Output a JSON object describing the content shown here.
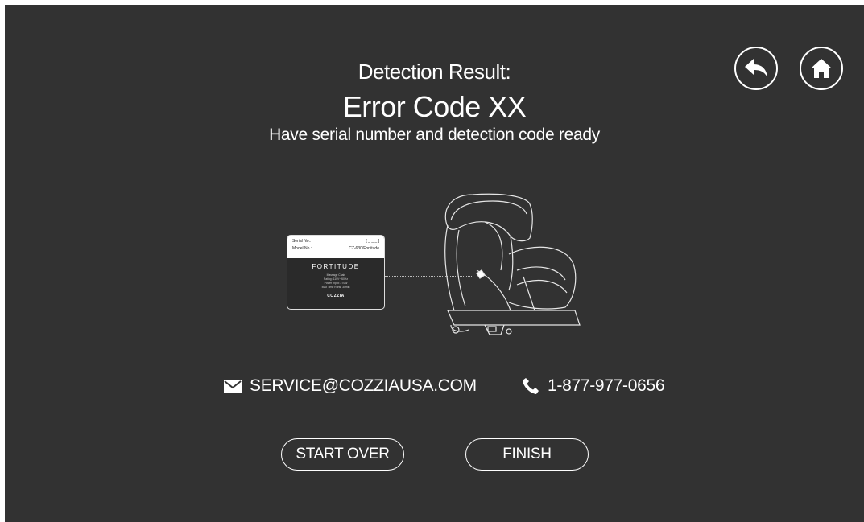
{
  "header": {
    "detection_label": "Detection Result:",
    "error_code": "Error Code XX",
    "instruction": "Have serial number and detection code ready"
  },
  "nav": {
    "back_icon": "back-arrow-icon",
    "home_icon": "home-icon"
  },
  "label_card": {
    "serial_label": "Serial No.:",
    "serial_value": "[ _ _ _ ]",
    "model_label": "Model No.:",
    "model_value": "CZ-630/Fortitude",
    "brand": "FORTITUDE",
    "fine_print": [
      "Massage Chair",
      "Rating: 110V~/60Hz",
      "Power Input: 270W",
      "Max Time Runs: 30min"
    ],
    "logo": "COZZIA"
  },
  "contact": {
    "email": "SERVICE@COZZIAUSA.COM",
    "email_icon": "envelope-icon",
    "phone": "1-877-977-0656",
    "phone_icon": "phone-icon"
  },
  "actions": {
    "start_over": "START OVER",
    "finish": "FINISH"
  },
  "colors": {
    "background": "#323232",
    "foreground": "#ffffff"
  }
}
